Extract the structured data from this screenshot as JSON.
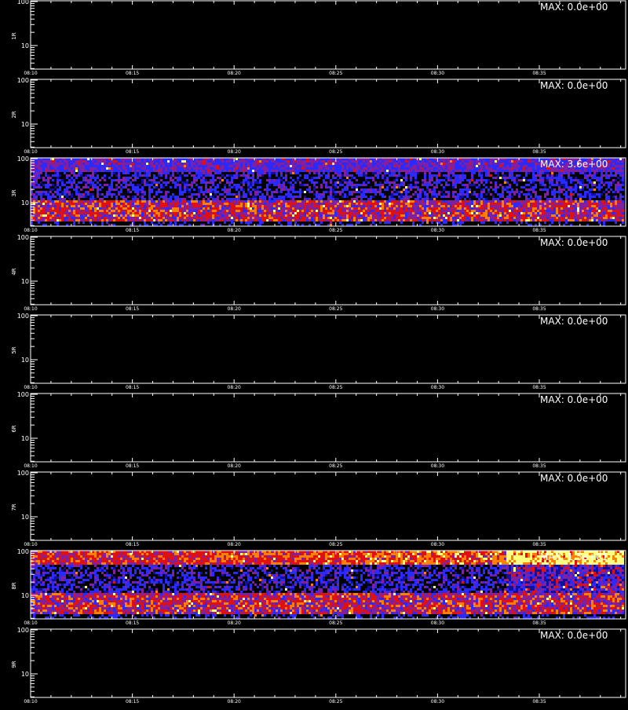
{
  "chart_data": [
    {
      "type": "heatmap",
      "ylabel": "1R",
      "max_label": "MAX: 0.0e+00",
      "active": false,
      "x_ticks": [
        "08:10",
        "08:15",
        "08:20",
        "08:25",
        "08:30",
        "08:35"
      ],
      "y_ticks": [
        "100",
        "10"
      ],
      "y_scale": "log"
    },
    {
      "type": "heatmap",
      "ylabel": "2R",
      "max_label": "MAX: 0.0e+00",
      "active": false,
      "x_ticks": [
        "08:10",
        "08:15",
        "08:20",
        "08:25",
        "08:30",
        "08:35"
      ],
      "y_ticks": [
        "100",
        "10"
      ],
      "y_scale": "log"
    },
    {
      "type": "heatmap",
      "ylabel": "3R",
      "max_label": "MAX: 3.6e+00",
      "active": true,
      "x_ticks": [
        "08:10",
        "08:15",
        "08:20",
        "08:25",
        "08:30",
        "08:35"
      ],
      "y_ticks": [
        "100",
        "10"
      ],
      "y_scale": "log"
    },
    {
      "type": "heatmap",
      "ylabel": "4R",
      "max_label": "MAX: 0.0e+00",
      "active": false,
      "x_ticks": [
        "08:10",
        "08:15",
        "08:20",
        "08:25",
        "08:30",
        "08:35"
      ],
      "y_ticks": [
        "100",
        "10"
      ],
      "y_scale": "log"
    },
    {
      "type": "heatmap",
      "ylabel": "5R",
      "max_label": "MAX: 0.0e+00",
      "active": false,
      "x_ticks": [
        "08:10",
        "08:15",
        "08:20",
        "08:25",
        "08:30",
        "08:35"
      ],
      "y_ticks": [
        "100",
        "10"
      ],
      "y_scale": "log"
    },
    {
      "type": "heatmap",
      "ylabel": "6R",
      "max_label": "MAX: 0.0e+00",
      "active": false,
      "x_ticks": [
        "08:10",
        "08:15",
        "08:20",
        "08:25",
        "08:30",
        "08:35"
      ],
      "y_ticks": [
        "100",
        "10"
      ],
      "y_scale": "log"
    },
    {
      "type": "heatmap",
      "ylabel": "7R",
      "max_label": "MAX: 0.0e+00",
      "active": false,
      "x_ticks": [
        "08:10",
        "08:15",
        "08:20",
        "08:25",
        "08:30",
        "08:35"
      ],
      "y_ticks": [
        "100",
        "10"
      ],
      "y_scale": "log"
    },
    {
      "type": "heatmap",
      "ylabel": "8R",
      "max_label": "MAX: 1.5e+01",
      "active": true,
      "x_ticks": [
        "08:10",
        "08:15",
        "08:20",
        "08:25",
        "08:30",
        "08:35"
      ],
      "y_ticks": [
        "100",
        "10"
      ],
      "y_scale": "log"
    },
    {
      "type": "heatmap",
      "ylabel": "9R",
      "max_label": "MAX: 0.0e+00",
      "active": false,
      "x_ticks": [
        "08:10",
        "08:15",
        "08:20",
        "08:25",
        "08:30",
        "08:35"
      ],
      "y_ticks": [
        "100",
        "10"
      ],
      "y_scale": "log"
    }
  ],
  "colors": {
    "background": "#000000",
    "axes": "#ffffff",
    "colormap": [
      "#000000",
      "#1010a0",
      "#2a2aff",
      "#8020a0",
      "#e01010",
      "#ff8000",
      "#ffff80"
    ]
  }
}
